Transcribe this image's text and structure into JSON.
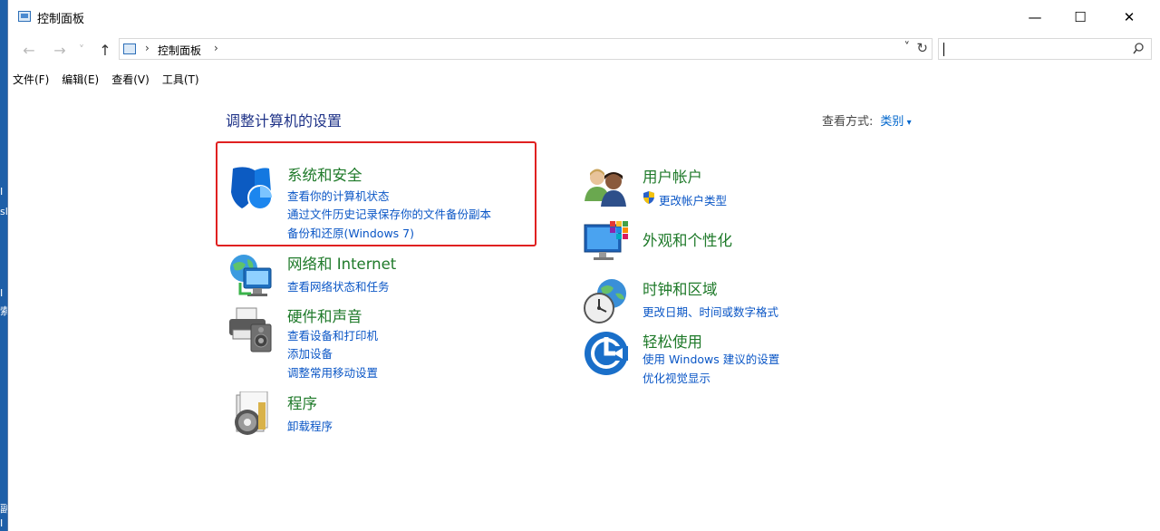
{
  "window": {
    "title": "控制面板",
    "minimize_glyph": "—",
    "maximize_glyph": "☐",
    "close_glyph": "✕"
  },
  "nav": {
    "back_glyph": "←",
    "forward_glyph": "→",
    "recent_glyph": "˅",
    "up_glyph": "↑",
    "address_sep": "›",
    "address_crumb": "控制面板",
    "address_dropdown_glyph": "˅",
    "refresh_glyph": "↻",
    "search_value": ""
  },
  "menubar": {
    "items": [
      "文件(F)",
      "编辑(E)",
      "查看(V)",
      "工具(T)"
    ]
  },
  "content": {
    "title": "调整计算机的设置",
    "view_by_label": "查看方式:",
    "view_by_value": "类别"
  },
  "categories": {
    "system": {
      "title": "系统和安全",
      "links": [
        "查看你的计算机状态",
        "通过文件历史记录保存你的文件备份副本",
        "备份和还原(Windows 7)"
      ]
    },
    "network": {
      "title": "网络和 Internet",
      "links": [
        "查看网络状态和任务"
      ]
    },
    "hardware": {
      "title": "硬件和声音",
      "links": [
        "查看设备和打印机",
        "添加设备",
        "调整常用移动设置"
      ]
    },
    "programs": {
      "title": "程序",
      "links": [
        "卸载程序"
      ]
    },
    "users": {
      "title": "用户帐户",
      "links": [
        "更改帐户类型"
      ]
    },
    "appearance": {
      "title": "外观和个性化",
      "links": []
    },
    "clock": {
      "title": "时钟和区域",
      "links": [
        "更改日期、时间或数字格式"
      ]
    },
    "ease": {
      "title": "轻松使用",
      "links": [
        "使用 Windows 建议的设置",
        "优化视觉显示"
      ]
    }
  },
  "desktop_fragments": [
    "I",
    "sle",
    "I",
    "索",
    "副",
    "I"
  ],
  "colors": {
    "category_title": "#1f7a2a",
    "link": "#0a56c6",
    "heading": "#1e3287",
    "highlight_border": "#e02020",
    "desktop": "#1e5fa8"
  }
}
